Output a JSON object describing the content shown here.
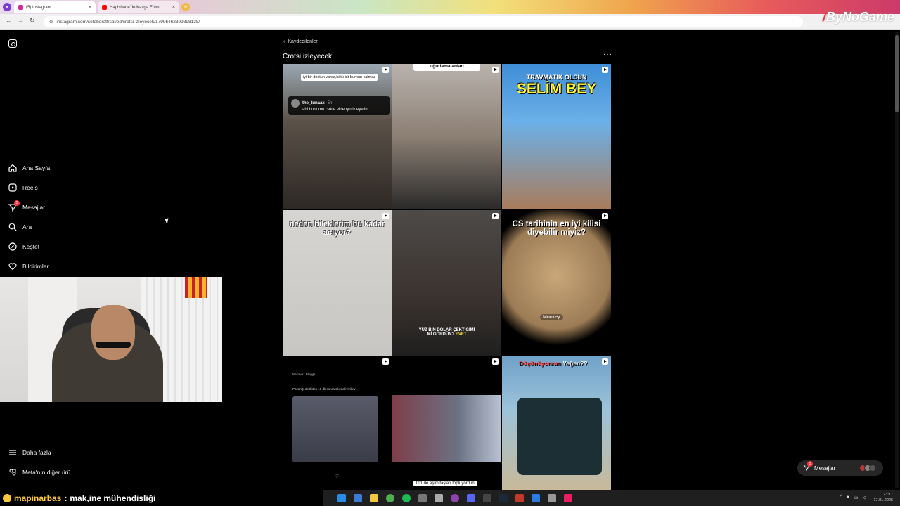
{
  "browser": {
    "profile_initial": "",
    "tabs": [
      {
        "label": "(5) Instagram",
        "active": true
      },
      {
        "label": "Hapishane'de Kavga Ettim...",
        "active": false
      }
    ],
    "url": "instagram.com/sefaberatt/saved/crotsi-izleyecek/17996462399898138/",
    "brand": "ByNoGame"
  },
  "sidebar": {
    "items": [
      {
        "label": "Ana Sayfa",
        "icon": "home-icon"
      },
      {
        "label": "Reels",
        "icon": "reels-icon"
      },
      {
        "label": "Mesajlar",
        "icon": "messages-icon",
        "badge": "5"
      },
      {
        "label": "Ara",
        "icon": "search-icon"
      },
      {
        "label": "Keşfet",
        "icon": "explore-icon"
      },
      {
        "label": "Bildirimler",
        "icon": "heart-icon"
      }
    ],
    "bottom_items": [
      {
        "label": "Daha fazla",
        "icon": "menu-icon"
      },
      {
        "label": "Meta'nın diğer ürü...",
        "icon": "meta-icon"
      }
    ]
  },
  "collection": {
    "back_label": "Kaydedilenler",
    "title": "Crotsi izleyecek",
    "more": "···"
  },
  "posts": {
    "p1": {
      "tag": "iyi bir dostun varsa,kötü bir burnun kalmaz",
      "user": "the_tunaax",
      "time": "5h",
      "comment": "abi bunumu cekte videoyu izleyelim"
    },
    "p2": {
      "band": "uğurlama anları"
    },
    "p3": {
      "line1": "TRAVMATİK OLSUN",
      "line2": "SELİM BEY"
    },
    "p4": {
      "caption": "neden bileklerim bu kadar acıyor?"
    },
    "p5": {
      "line1": "YÜZ BİN DOLAR ÇEKTİĞİMİ",
      "line2": "Mİ GÖRDÜN?",
      "evet": "EVET"
    },
    "p6": {
      "caption": "CS tarihinin en iyi kilisi diyebilir miyiz?",
      "watermark": "Monkey"
    },
    "p7": {
      "author": "Nakavaz Bloggs",
      "text": "Pazarığı dedikten 10 dk sonra sikzadevizikıw"
    },
    "p8": {
      "caption": "101 de eşim taşları topluyordun"
    },
    "p9": {
      "caption_red": "Düşünüyorsun",
      "caption_white": "Yeğen??"
    }
  },
  "messages_pill": {
    "label": "Mesajlar",
    "badge": "5"
  },
  "chat_overlay": {
    "username": "mapinarbas",
    "separator": ":",
    "message": "mak,ine mühendisliği"
  },
  "taskbar": {
    "time": "23:17",
    "date": "17.01.2026"
  }
}
